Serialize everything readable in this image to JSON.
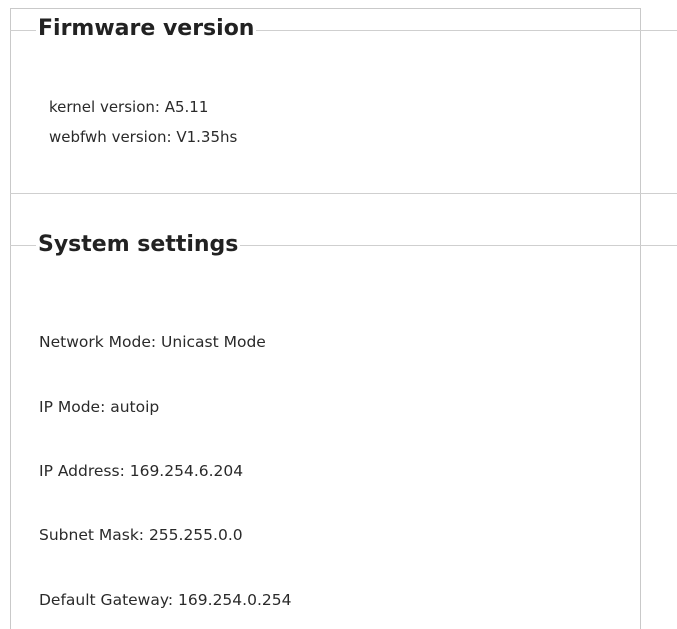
{
  "firmware": {
    "heading": "Firmware version",
    "kernel_version": "kernel version: A5.11",
    "webfwh_version": "webfwh version: V1.35hs"
  },
  "system": {
    "heading": "System settings",
    "network_mode": "Network Mode: Unicast Mode",
    "ip_mode": "IP Mode: autoip",
    "ip_address": "IP Address: 169.254.6.204",
    "subnet_mask": "Subnet Mask: 255.255.0.0",
    "default_gateway": "Default Gateway: 169.254.0.254"
  }
}
